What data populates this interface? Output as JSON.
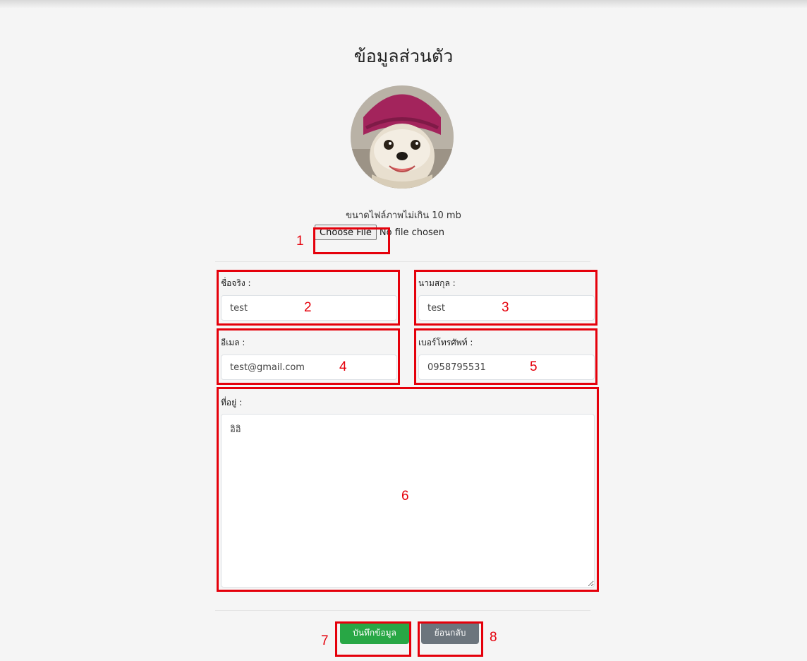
{
  "page": {
    "title": "ข้อมูลส่วนตัว"
  },
  "avatar": {
    "alt": "profile-picture"
  },
  "upload": {
    "hint": "ขนาดไฟล์ภาพไม่เกิน 10 mb",
    "button_label": "Choose File",
    "status": "No file chosen"
  },
  "form": {
    "first_name": {
      "label": "ชื่อจริง :",
      "value": "test"
    },
    "last_name": {
      "label": "นามสกุล :",
      "value": "test"
    },
    "email": {
      "label": "อีเมล :",
      "value": "test@gmail.com"
    },
    "phone": {
      "label": "เบอร์โทรศัพท์ :",
      "value": "0958795531"
    },
    "address": {
      "label": "ที่อยู่ :",
      "value": "อิอิ"
    }
  },
  "actions": {
    "save_label": "บันทึกข้อมูล",
    "back_label": "ย้อนกลับ"
  },
  "annotations": [
    "1",
    "2",
    "3",
    "4",
    "5",
    "6",
    "7",
    "8"
  ],
  "colors": {
    "annotation": "#e5000b",
    "save": "#28a745",
    "back": "#6c757d"
  }
}
